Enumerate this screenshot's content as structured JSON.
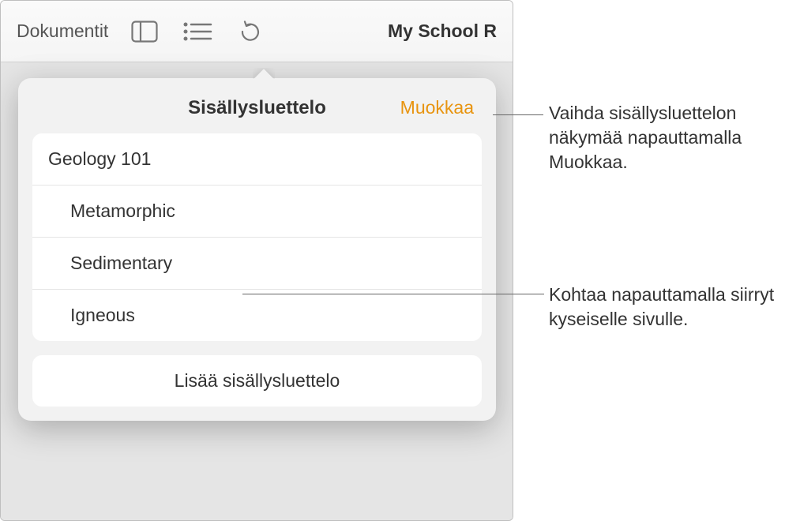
{
  "toolbar": {
    "back_label": "Dokumentit",
    "document_title": "My School R"
  },
  "popover": {
    "title": "Sisällysluettelo",
    "edit_label": "Muokkaa",
    "items": [
      {
        "label": "Geology 101",
        "indent": false
      },
      {
        "label": "Metamorphic",
        "indent": true
      },
      {
        "label": "Sedimentary",
        "indent": true
      },
      {
        "label": "Igneous",
        "indent": true
      }
    ],
    "add_button_label": "Lisää sisällysluettelo"
  },
  "callouts": {
    "edit": "Vaihda sisällysluettelon näkymää napauttamalla Muokkaa.",
    "item": "Kohtaa napauttamalla siirryt kyseiselle sivulle."
  }
}
